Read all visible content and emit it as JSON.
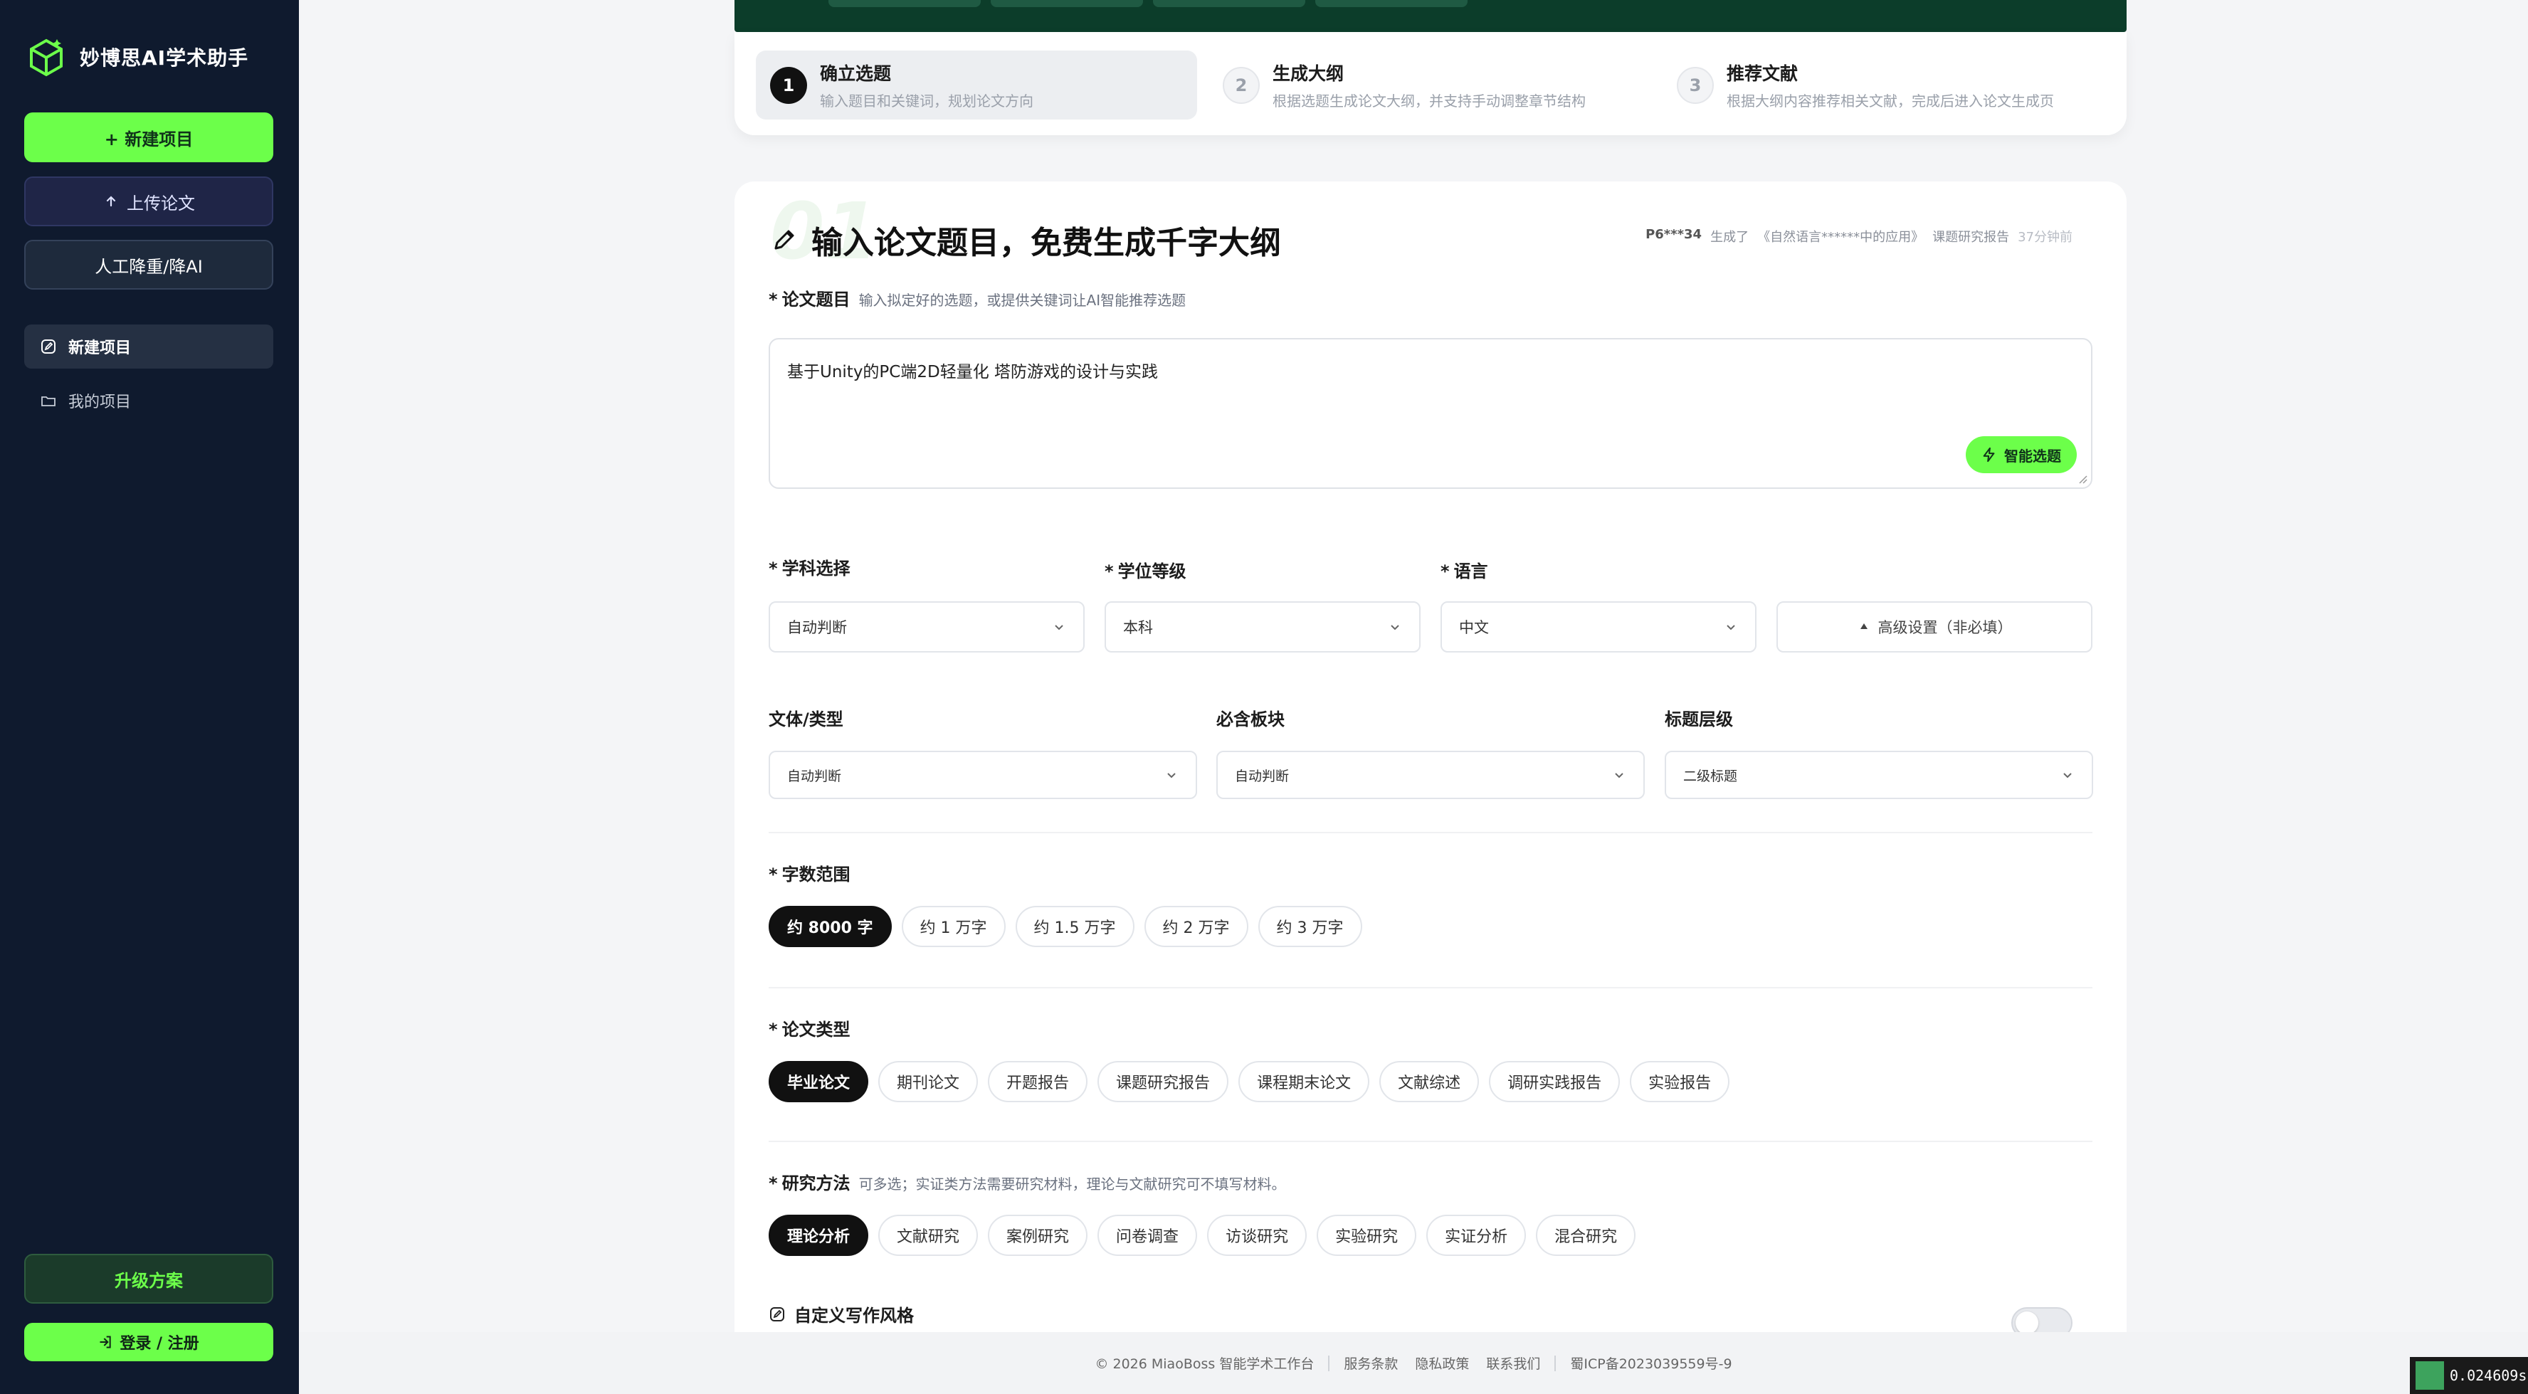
{
  "app": {
    "name": "妙博思AI学术助手"
  },
  "sidebar": {
    "new_project_btn": "+ 新建项目",
    "upload_btn": "上传论文",
    "ai_btn": "人工降重/降AI",
    "nav": [
      {
        "label": "新建项目",
        "icon": "edit-icon",
        "active": true
      },
      {
        "label": "我的项目",
        "icon": "folder-icon",
        "active": false
      }
    ],
    "upgrade_btn": "升级方案",
    "login_btn": "登录 / 注册"
  },
  "steps": [
    {
      "num": "1",
      "title": "确立选题",
      "desc": "输入题目和关键词，规划论文方向"
    },
    {
      "num": "2",
      "title": "生成大纲",
      "desc": "根据选题生成论文大纲，并支持手动调整章节结构"
    },
    {
      "num": "3",
      "title": "推荐文献",
      "desc": "根据大纲内容推荐相关文献，完成后进入论文生成页"
    }
  ],
  "form": {
    "section_number": "01",
    "title": "输入论文题目，免费生成千字大纲",
    "ticker": {
      "user": "P6***34",
      "action": "生成了",
      "topic": "《自然语言******中的应用》",
      "type": "课题研究报告",
      "time": "37分钟前"
    },
    "topic": {
      "label": "论文题目",
      "hint": "输入拟定好的选题，或提供关键词让AI智能推荐选题",
      "value": "基于Unity的PC端2D轻量化 塔防游戏的设计与实践",
      "smart_btn": "智能选题"
    },
    "subject": {
      "label": "学科选择",
      "value": "自动判断"
    },
    "degree": {
      "label": "学位等级",
      "value": "本科"
    },
    "language": {
      "label": "语言",
      "value": "中文"
    },
    "advanced": "高级设置（非必填）",
    "genre": {
      "label": "文体/类型",
      "value": "自动判断"
    },
    "required_section": {
      "label": "必含板块",
      "value": "自动判断"
    },
    "heading_level": {
      "label": "标题层级",
      "value": "二级标题"
    },
    "word_count": {
      "label": "字数范围",
      "options": [
        "约 8000 字",
        "约 1 万字",
        "约 1.5 万字",
        "约 2 万字",
        "约 3 万字"
      ],
      "selected": 0
    },
    "paper_type": {
      "label": "论文类型",
      "options": [
        "毕业论文",
        "期刊论文",
        "开题报告",
        "课题研究报告",
        "课程期末论文",
        "文献综述",
        "调研实践报告",
        "实验报告"
      ],
      "selected": 0
    },
    "method": {
      "label": "研究方法",
      "hint": "可多选；实证类方法需要研究材料，理论与文献研究可不填写材料。",
      "options": [
        "理论分析",
        "文献研究",
        "案例研究",
        "问卷调查",
        "访谈研究",
        "实验研究",
        "实证分析",
        "混合研究"
      ],
      "selected": 0
    },
    "custom_style": {
      "label": "自定义写作风格"
    }
  },
  "footer": {
    "copyright": "© 2026 MiaoBoss 智能学术工作台",
    "links": [
      "服务条款",
      "隐私政策",
      "联系我们"
    ],
    "icp": "蜀ICP备2023039559号-9"
  },
  "corner_badge": "0.024609s",
  "colors": {
    "accent": "#6cff4a",
    "sidebar": "#0f1a2e",
    "dark": "#111111"
  }
}
